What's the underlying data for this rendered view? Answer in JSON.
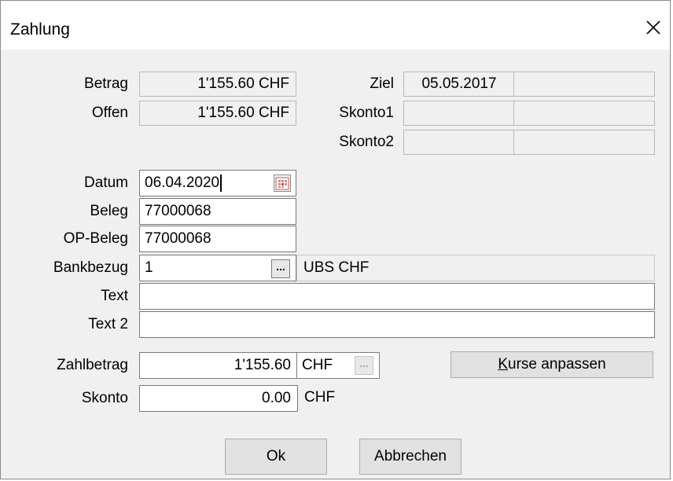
{
  "window": {
    "title": "Zahlung"
  },
  "info": {
    "betrag_label": "Betrag",
    "betrag_value": "1'155.60 CHF",
    "offen_label": "Offen",
    "offen_value": "1'155.60 CHF",
    "ziel_label": "Ziel",
    "ziel_value": "05.05.2017",
    "skonto1_label": "Skonto1",
    "skonto2_label": "Skonto2"
  },
  "form": {
    "datum_label": "Datum",
    "datum_value": "06.04.2020",
    "beleg_label": "Beleg",
    "beleg_value": "77000068",
    "opbeleg_label": "OP-Beleg",
    "opbeleg_value": "77000068",
    "bankbezug_label": "Bankbezug",
    "bankbezug_value": "1",
    "bankbezug_name": "UBS CHF",
    "text_label": "Text",
    "text_value": "",
    "text2_label": "Text 2",
    "text2_value": "",
    "zahlbetrag_label": "Zahlbetrag",
    "zahlbetrag_value": "1'155.60",
    "zahlbetrag_currency": "CHF",
    "skonto_label": "Skonto",
    "skonto_value": "0.00",
    "skonto_currency": "CHF"
  },
  "buttons": {
    "browse": "...",
    "kurse_first": "K",
    "kurse_rest": "urse anpassen",
    "ok": "Ok",
    "cancel": "Abbrechen"
  },
  "icons": {
    "close": "close-icon",
    "calendar": "calendar-icon"
  }
}
